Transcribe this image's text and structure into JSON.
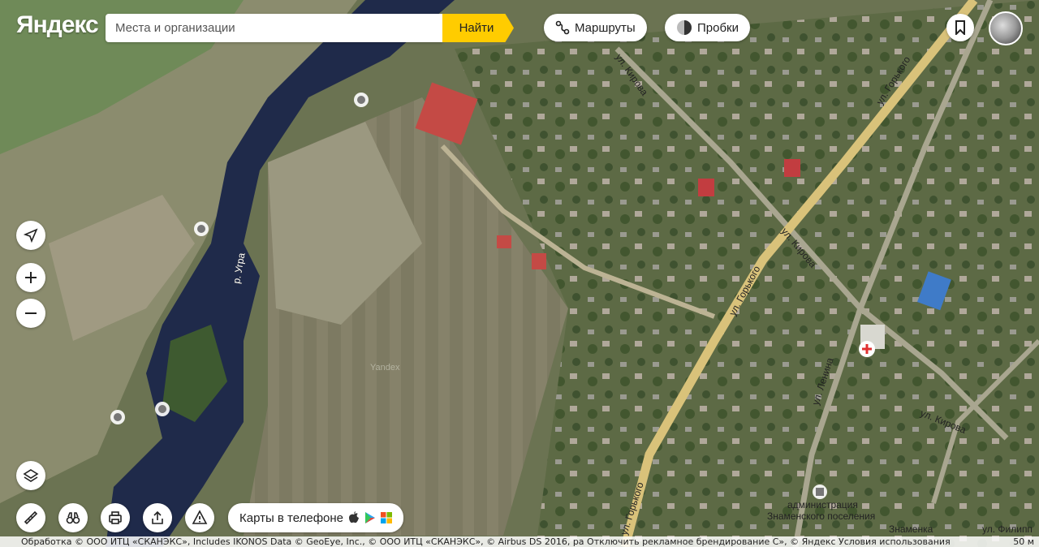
{
  "header": {
    "logo": "Яндекс",
    "search_placeholder": "Места и организации",
    "find_label": "Найти",
    "routes_label": "Маршруты",
    "traffic_label": "Пробки"
  },
  "bottom": {
    "phone_label": "Карты в телефоне",
    "copyright": "Обработка © ООО ИТЦ «СКАНЭКС», Includes IKONOS Data © GeoEye, Inc., © ООО ИТЦ «СКАНЭКС», © Airbus DS 2016, ра Отключить рекламное брендирование С», © Яндекс Условия использования",
    "scale": "50 м"
  },
  "map_labels": {
    "river": "р. Угра",
    "watermark": "Yandex",
    "street_gorkogo_1": "ул. Горького",
    "street_gorkogo_2": "ул. Горького",
    "street_gorkogo_3": "ул. Горького",
    "street_kirova_1": "ул. Кирова",
    "street_kirova_2": "ул. Кирова",
    "street_kirova_3": "ул. Кирова",
    "street_lenina": "ул. Ленина",
    "admin_line1": "администрация",
    "admin_line2": "Знаменского поселения",
    "village": "Знаменка",
    "street_filipp": "ул. Филипп"
  },
  "colors": {
    "accent": "#ffcc00",
    "road": "#d9c27a"
  },
  "icons": [
    "yandex-logo",
    "routes-icon",
    "traffic-icon",
    "bookmark-icon",
    "locate-icon",
    "zoom-in-icon",
    "zoom-out-icon",
    "layers-icon",
    "ruler-icon",
    "panorama-icon",
    "print-icon",
    "share-icon",
    "warning-icon",
    "apple-icon",
    "play-icon",
    "windows-icon",
    "beach-icon",
    "hospital-icon",
    "admin-building-icon"
  ]
}
